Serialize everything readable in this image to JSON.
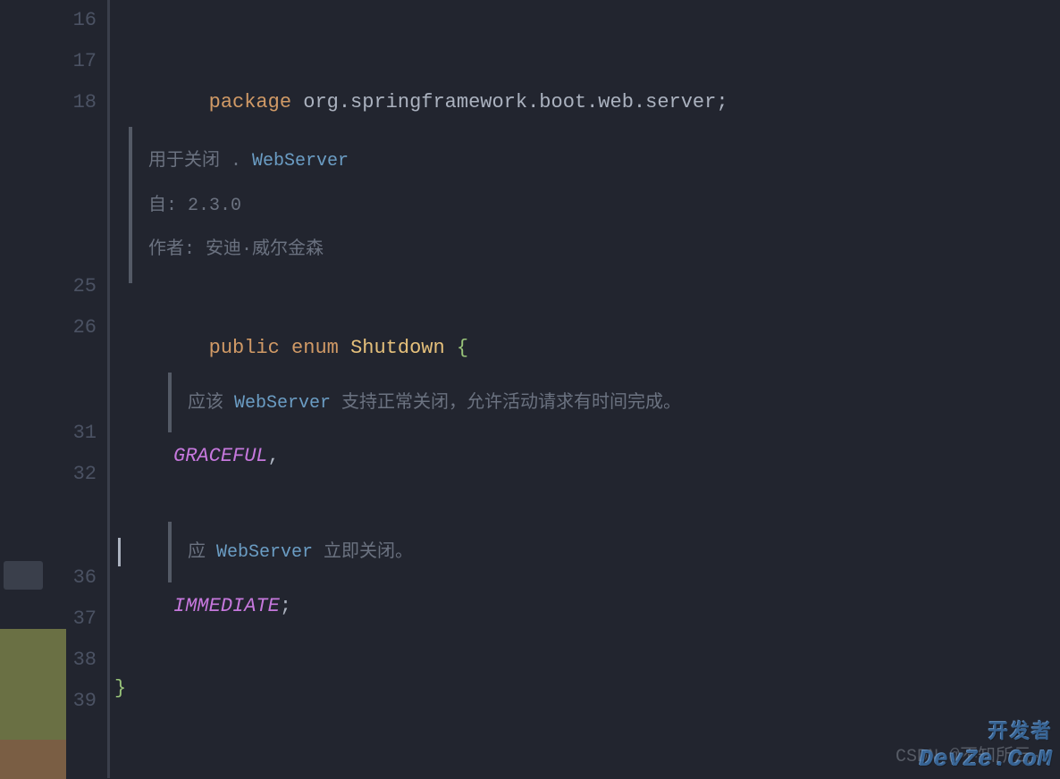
{
  "gutter": {
    "lines": [
      "16",
      "17",
      "18",
      "",
      "25",
      "26",
      "",
      "31",
      "32",
      "",
      "36",
      "37",
      "38",
      "39"
    ]
  },
  "code": {
    "pkg_kw": "package",
    "pkg_name": " org.springframework.boot.web.server",
    "semicolon": ";",
    "pub_kw": "public",
    "enum_kw": " enum ",
    "class_name": "Shutdown",
    "open_brace": " {",
    "graceful": "GRACEFUL",
    "comma": ",",
    "immediate": "IMMEDIATE",
    "close_brace": "}"
  },
  "doc1": {
    "row1_pre": "用于关闭 . ",
    "row1_link": "WebServer",
    "row2_label": "自:",
    "row2_val": "   2.3.0",
    "row3_label": "作者: ",
    "row3_val": "安迪·威尔金森"
  },
  "doc2": {
    "pre": "应该  ",
    "link": "WebServer",
    "post": "  支持正常关闭，允许活动请求有时间完成。"
  },
  "doc3": {
    "pre": "应  ",
    "link": "WebServer",
    "post": "  立即关闭。"
  },
  "watermarks": {
    "csdn": "CSDN @不知所云·",
    "devze": "DevZe.CoM",
    "tag": "开发者"
  }
}
